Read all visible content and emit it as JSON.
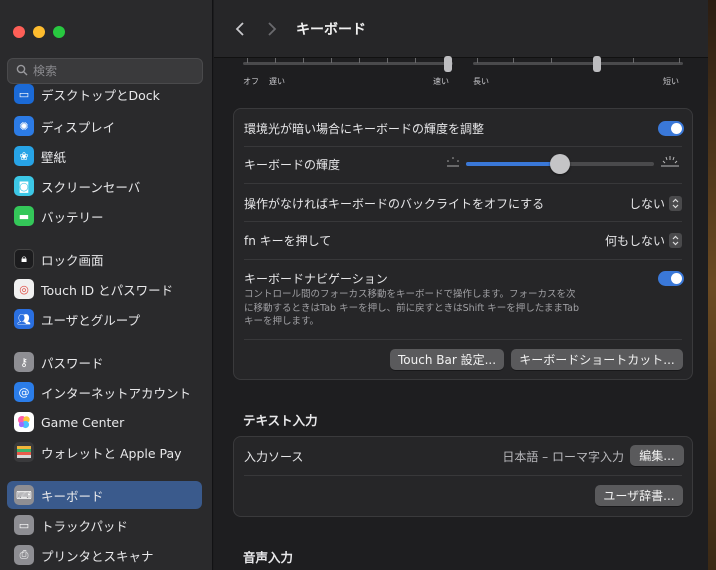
{
  "window": {
    "title": "キーボード"
  },
  "sidebar": {
    "search_placeholder": "検索",
    "items": [
      {
        "label": "デスクトップとDock",
        "icon": "desktop-dock-icon",
        "color": "#1b6ad6"
      },
      {
        "label": "ディスプレイ",
        "icon": "display-icon",
        "color": "#2c7be5"
      },
      {
        "label": "壁紙",
        "icon": "wallpaper-icon",
        "color": "#27a3e6"
      },
      {
        "label": "スクリーンセーバ",
        "icon": "screensaver-icon",
        "color": "#3cc7e6"
      },
      {
        "label": "バッテリー",
        "icon": "battery-icon",
        "color": "#34c759"
      },
      {
        "label": "ロック画面",
        "icon": "lock-icon",
        "color": "#1c1c1e"
      },
      {
        "label": "Touch ID とパスワード",
        "icon": "fingerprint-icon",
        "color": "#f1f1f1"
      },
      {
        "label": "ユーザとグループ",
        "icon": "users-icon",
        "color": "#2a6fe0"
      },
      {
        "label": "パスワード",
        "icon": "key-icon",
        "color": "#8e8e93"
      },
      {
        "label": "インターネットアカウント",
        "icon": "at-icon",
        "color": "#2b7de9"
      },
      {
        "label": "Game Center",
        "icon": "game-center-icon",
        "color": "#ffffff"
      },
      {
        "label": "ウォレットと Apple Pay",
        "icon": "wallet-icon",
        "color": "#3a3a3c"
      },
      {
        "label": "キーボード",
        "icon": "keyboard-icon",
        "color": "#8e8e93"
      },
      {
        "label": "トラックパッド",
        "icon": "trackpad-icon",
        "color": "#8e8e93"
      },
      {
        "label": "プリンタとスキャナ",
        "icon": "printer-icon",
        "color": "#8e8e93"
      }
    ],
    "active_index": 12
  },
  "rate_sliders": {
    "repeat_labels": [
      "オフ",
      "遅い",
      "速い"
    ],
    "delay_labels": [
      "長い",
      "短い"
    ]
  },
  "settings": {
    "auto_brightness_label": "環境光が暗い場合にキーボードの輝度を調整",
    "auto_brightness_on": true,
    "brightness_label": "キーボードの輝度",
    "brightness_value": 0.5,
    "backlight_off_label": "操作がなければキーボードのバックライトをオフにする",
    "backlight_off_value": "しない",
    "fn_label": "fn キーを押して",
    "fn_value": "何もしない",
    "kb_nav_label": "キーボードナビゲーション",
    "kb_nav_on": true,
    "kb_nav_desc_1": "コントロール間のフォーカス移動をキーボードで操作します。フォーカスを次",
    "kb_nav_desc_2": "に移動するときはTab キーを押し、前に戻すときはShift キーを押したままTab",
    "kb_nav_desc_3": "キーを押します。",
    "touch_bar_btn": "Touch Bar 設定...",
    "shortcuts_btn": "キーボードショートカット..."
  },
  "text_input": {
    "heading": "テキスト入力",
    "source_label": "入力ソース",
    "source_value": "日本語 – ローマ字入力",
    "edit_btn": "編集...",
    "dict_btn": "ユーザ辞書..."
  },
  "voice_input": {
    "heading": "音声入力"
  },
  "colors": {
    "accent": "#3a78d8",
    "sidebar_active": "#3a5a8c"
  }
}
